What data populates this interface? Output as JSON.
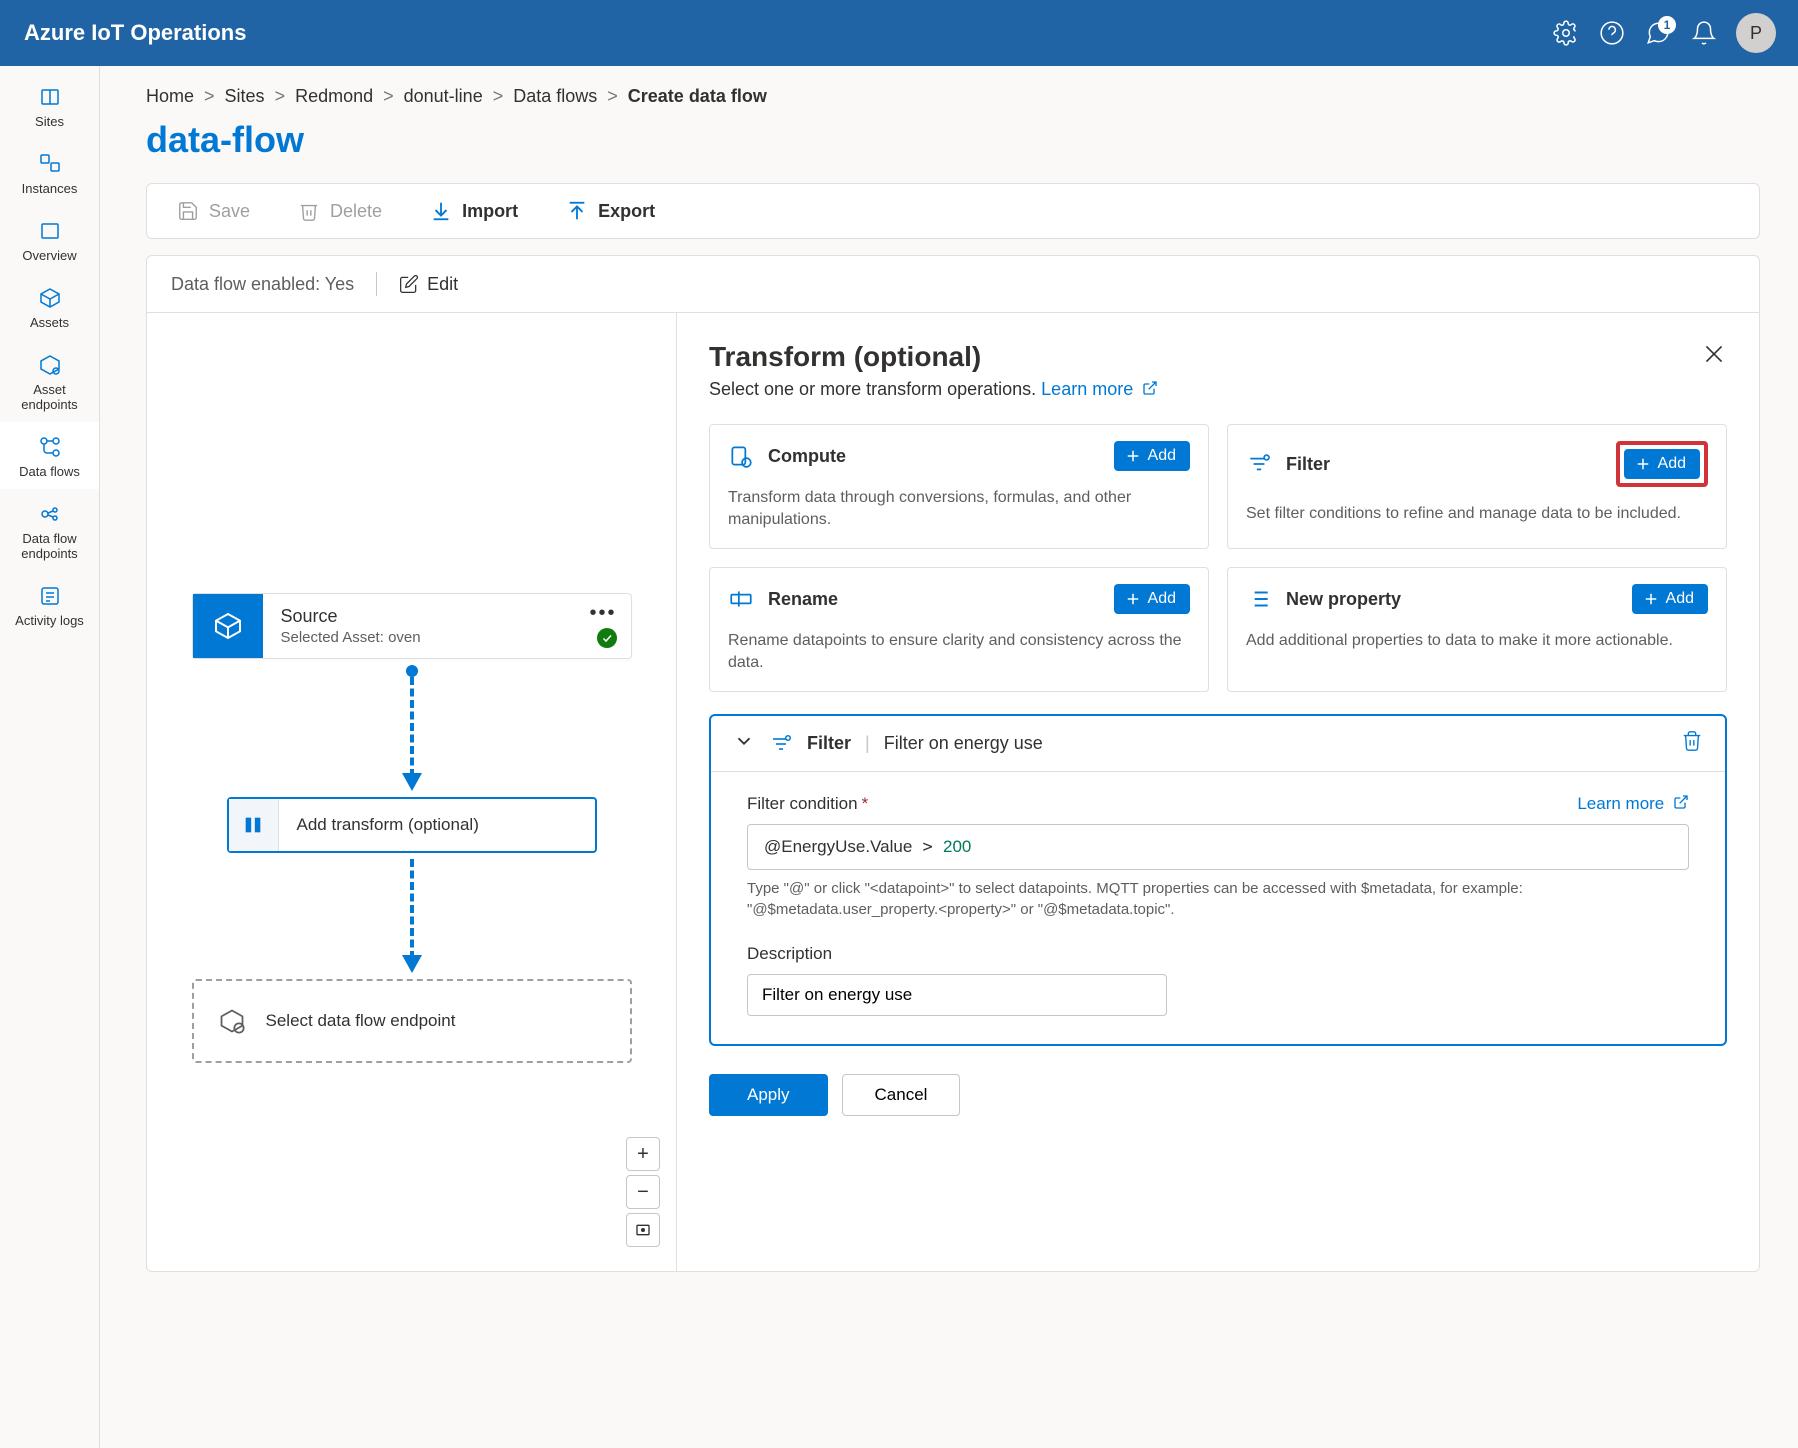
{
  "header": {
    "title": "Azure IoT Operations",
    "notification_count": "1",
    "avatar_initial": "P"
  },
  "sidebar": {
    "items": [
      {
        "label": "Sites"
      },
      {
        "label": "Instances"
      },
      {
        "label": "Overview"
      },
      {
        "label": "Assets"
      },
      {
        "label": "Asset endpoints"
      },
      {
        "label": "Data flows"
      },
      {
        "label": "Data flow endpoints"
      },
      {
        "label": "Activity logs"
      }
    ]
  },
  "breadcrumbs": {
    "items": [
      "Home",
      "Sites",
      "Redmond",
      "donut-line",
      "Data flows"
    ],
    "current": "Create data flow"
  },
  "page": {
    "title": "data-flow"
  },
  "toolbar": {
    "save": "Save",
    "delete": "Delete",
    "import": "Import",
    "export": "Export"
  },
  "status": {
    "enabled_text": "Data flow enabled: Yes",
    "edit": "Edit"
  },
  "canvas": {
    "source": {
      "title": "Source",
      "subtitle": "Selected Asset: oven"
    },
    "transform_node": "Add transform (optional)",
    "endpoint_node": "Select data flow endpoint"
  },
  "panel": {
    "title": "Transform (optional)",
    "sub": "Select one or more transform operations.",
    "learn_more": "Learn more",
    "cards": [
      {
        "title": "Compute",
        "desc": "Transform data through conversions, formulas, and other manipulations.",
        "add": "Add"
      },
      {
        "title": "Filter",
        "desc": "Set filter conditions to refine and manage data to be included.",
        "add": "Add"
      },
      {
        "title": "Rename",
        "desc": "Rename datapoints to ensure clarity and consistency across the data.",
        "add": "Add"
      },
      {
        "title": "New property",
        "desc": "Add additional properties to data to make it more actionable.",
        "add": "Add"
      }
    ],
    "filter_op": {
      "type_label": "Filter",
      "name": "Filter on energy use",
      "cond_label": "Filter condition",
      "learn_more": "Learn more",
      "cond_value": "@EnergyUse.Value > 200",
      "cond_help": "Type \"@\" or click \"<datapoint>\" to select datapoints. MQTT properties can be accessed with $metadata, for example: \"@$metadata.user_property.<property>\" or \"@$metadata.topic\".",
      "desc_label": "Description",
      "desc_value": "Filter on energy use"
    },
    "footer": {
      "apply": "Apply",
      "cancel": "Cancel"
    }
  }
}
